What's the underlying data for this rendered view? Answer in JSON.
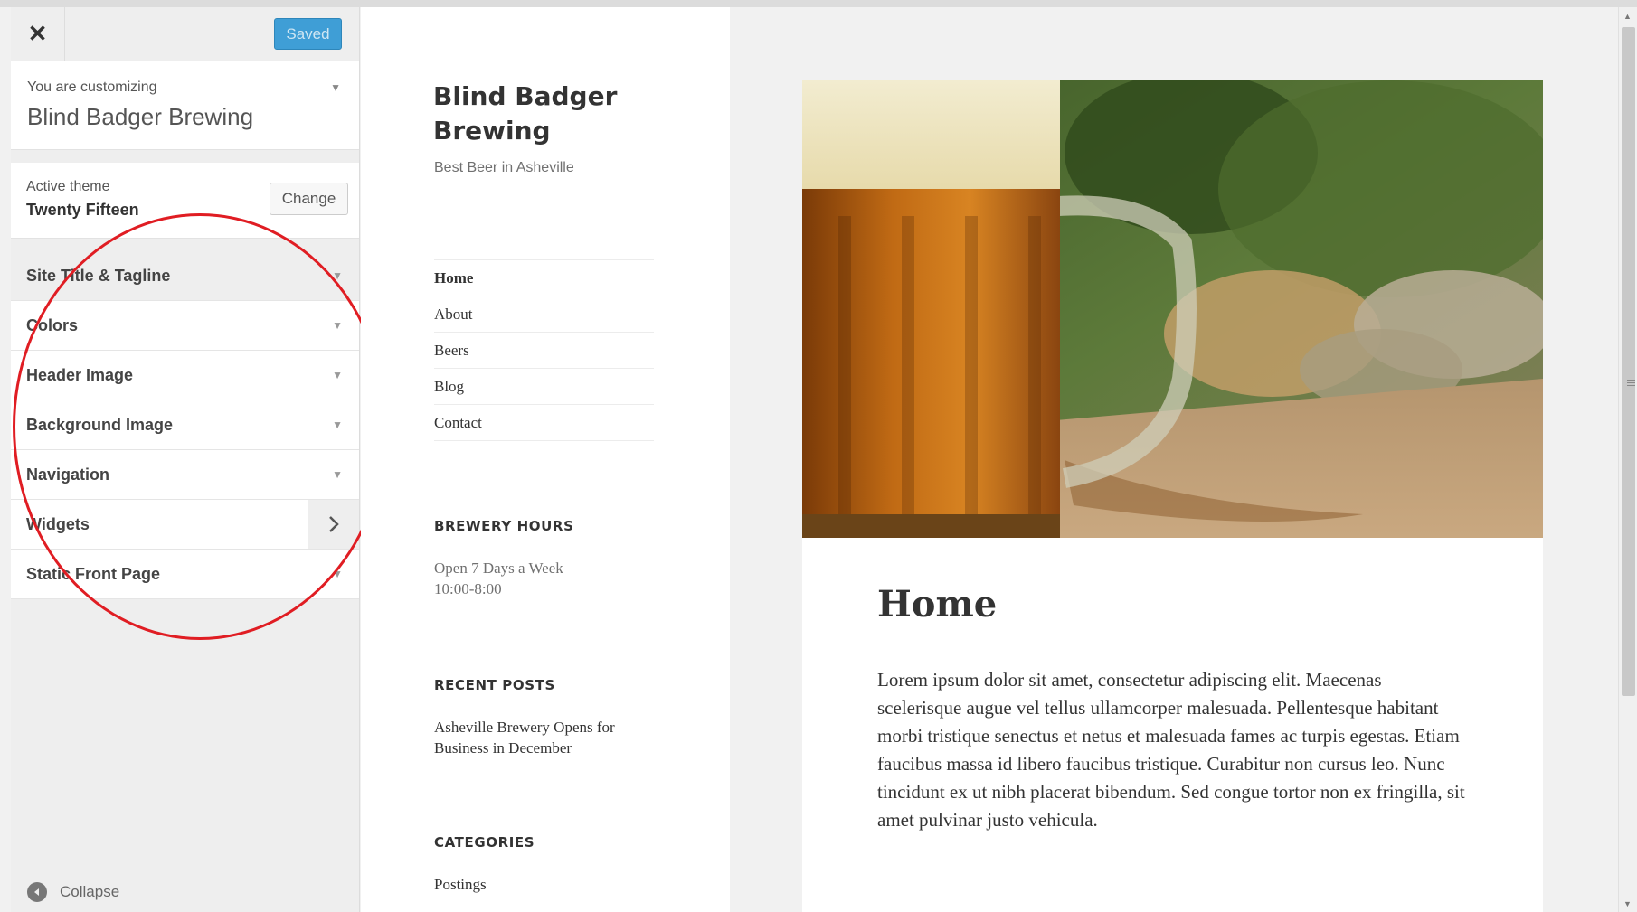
{
  "customizer": {
    "saved_label": "Saved",
    "customizing_label": "You are customizing",
    "site_name": "Blind Badger Brewing",
    "active_theme_label": "Active theme",
    "theme_name": "Twenty Fifteen",
    "change_label": "Change",
    "sections": [
      {
        "label": "Site Title & Tagline"
      },
      {
        "label": "Colors"
      },
      {
        "label": "Header Image"
      },
      {
        "label": "Background Image"
      },
      {
        "label": "Navigation"
      },
      {
        "label": "Widgets"
      },
      {
        "label": "Static Front Page"
      }
    ],
    "collapse_label": "Collapse",
    "annotation_color": "#e01d23",
    "accent_color": "#3f9ed6"
  },
  "site": {
    "title": "Blind Badger Brewing",
    "tagline": "Best Beer in Asheville",
    "nav": [
      "Home",
      "About",
      "Beers",
      "Blog",
      "Contact"
    ],
    "widgets": {
      "hours_title": "BREWERY HOURS",
      "hours_line1": "Open 7 Days a Week",
      "hours_line2": "10:00-8:00",
      "recent_title": "RECENT POSTS",
      "recent_post_line1": "Asheville Brewery Opens for",
      "recent_post_line2": "Business in December",
      "categories_title": "CATEGORIES",
      "category": "Postings"
    }
  },
  "page": {
    "title": "Home",
    "content": "Lorem ipsum dolor sit amet, consectetur adipiscing elit. Maecenas scelerisque augue vel tellus ullamcorper malesuada. Pellentesque habitant morbi tristique senectus et netus et malesuada fames ac turpis egestas. Etiam faucibus massa id libero faucibus tristique. Curabitur non cursus leo. Nunc tincidunt ex ut nibh placerat bibendum. Sed congue tortor non ex fringilla, sit amet pulvinar justo vehicula."
  }
}
